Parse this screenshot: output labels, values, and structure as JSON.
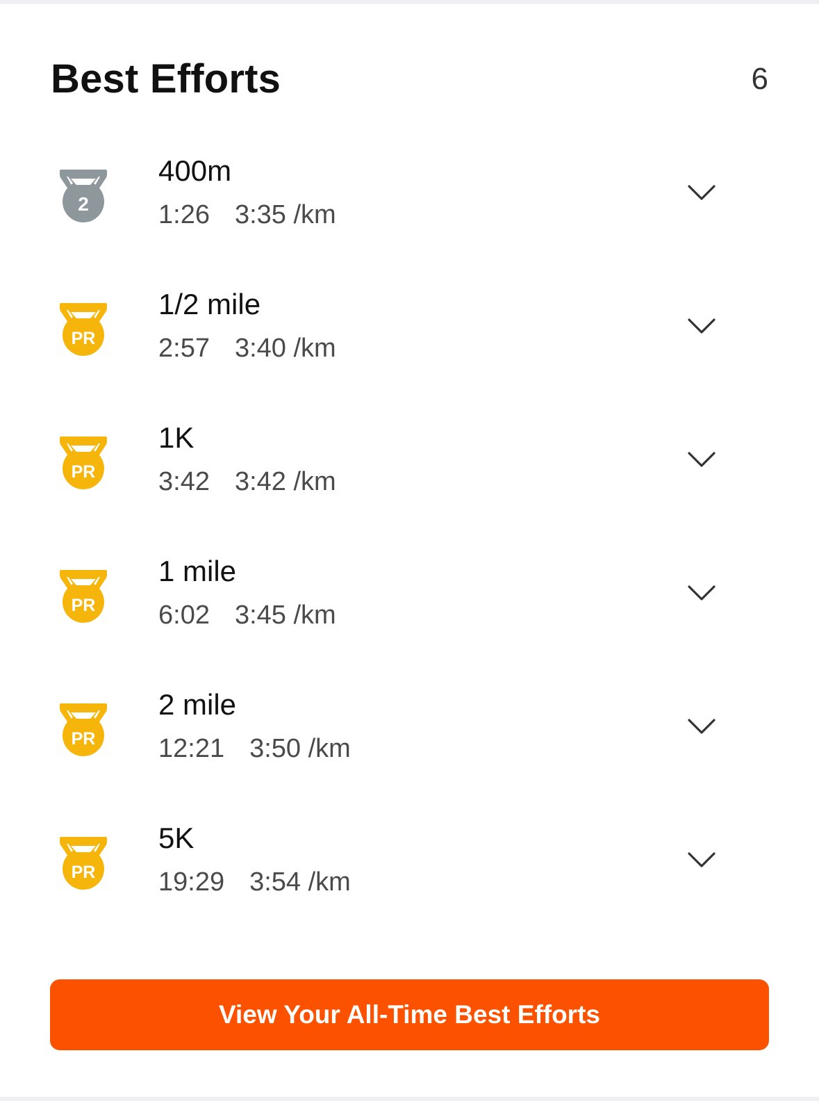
{
  "header": {
    "title": "Best Efforts",
    "count": "6"
  },
  "efforts": [
    {
      "name": "400m",
      "time": "1:26",
      "pace": "3:35 /km",
      "badge": "2",
      "badge_icon": "silver-medal-icon",
      "badge_color": "#8e979b"
    },
    {
      "name": "1/2 mile",
      "time": "2:57",
      "pace": "3:40 /km",
      "badge": "PR",
      "badge_icon": "pr-medal-icon",
      "badge_color": "#f5b50a"
    },
    {
      "name": "1K",
      "time": "3:42",
      "pace": "3:42 /km",
      "badge": "PR",
      "badge_icon": "pr-medal-icon",
      "badge_color": "#f5b50a"
    },
    {
      "name": "1 mile",
      "time": "6:02",
      "pace": "3:45 /km",
      "badge": "PR",
      "badge_icon": "pr-medal-icon",
      "badge_color": "#f5b50a"
    },
    {
      "name": "2 mile",
      "time": "12:21",
      "pace": "3:50 /km",
      "badge": "PR",
      "badge_icon": "pr-medal-icon",
      "badge_color": "#f5b50a"
    },
    {
      "name": "5K",
      "time": "19:29",
      "pace": "3:54 /km",
      "badge": "PR",
      "badge_icon": "pr-medal-icon",
      "badge_color": "#f5b50a"
    }
  ],
  "cta": {
    "label": "View Your All-Time Best Efforts",
    "color": "#fc5200"
  },
  "icons": {
    "expand": "chevron-down-icon"
  }
}
